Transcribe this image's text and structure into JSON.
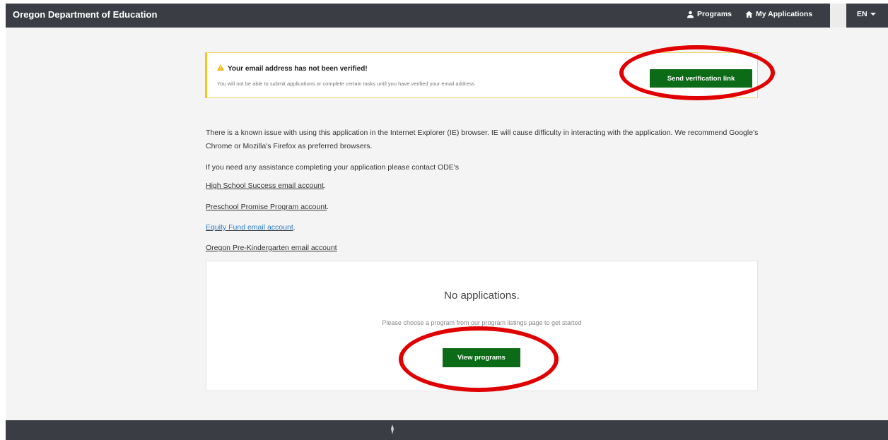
{
  "navbar": {
    "brand": "Oregon Department of Education",
    "programs_label": "Programs",
    "my_applications_label": "My Applications",
    "language_label": "EN"
  },
  "alert": {
    "title": "Your email address has not been verified!",
    "text": "You will not be able to submit applications or complete certain tasks until you have verified your email address",
    "button_label": "Send verification link"
  },
  "content": {
    "ie_notice": "There is a known issue with using this application in the Internet Explorer (IE) browser. IE will cause difficulty in interacting with the application. We recommend Google's Chrome or Mozilla's Firefox as preferred browsers.",
    "assistance_text": "If you need any assistance completing your application please contact ODE's",
    "links": [
      {
        "label": "High School Success email account",
        "suffix": "."
      },
      {
        "label": "Preschool Promise Program account",
        "suffix": "."
      },
      {
        "label": "Equity Fund email account",
        "suffix": "."
      },
      {
        "label": "Oregon Pre-Kindergarten email account",
        "suffix": ""
      }
    ]
  },
  "empty_state": {
    "title": "No applications.",
    "subtitle": "Please choose a program from our program listings page to get started",
    "button_label": "View programs"
  },
  "colors": {
    "navbar": "#3a3e44",
    "primary_button": "#0b6b16",
    "warning": "#f5c518",
    "annotation": "#e00000",
    "link_blue": "#2a7bc4"
  }
}
